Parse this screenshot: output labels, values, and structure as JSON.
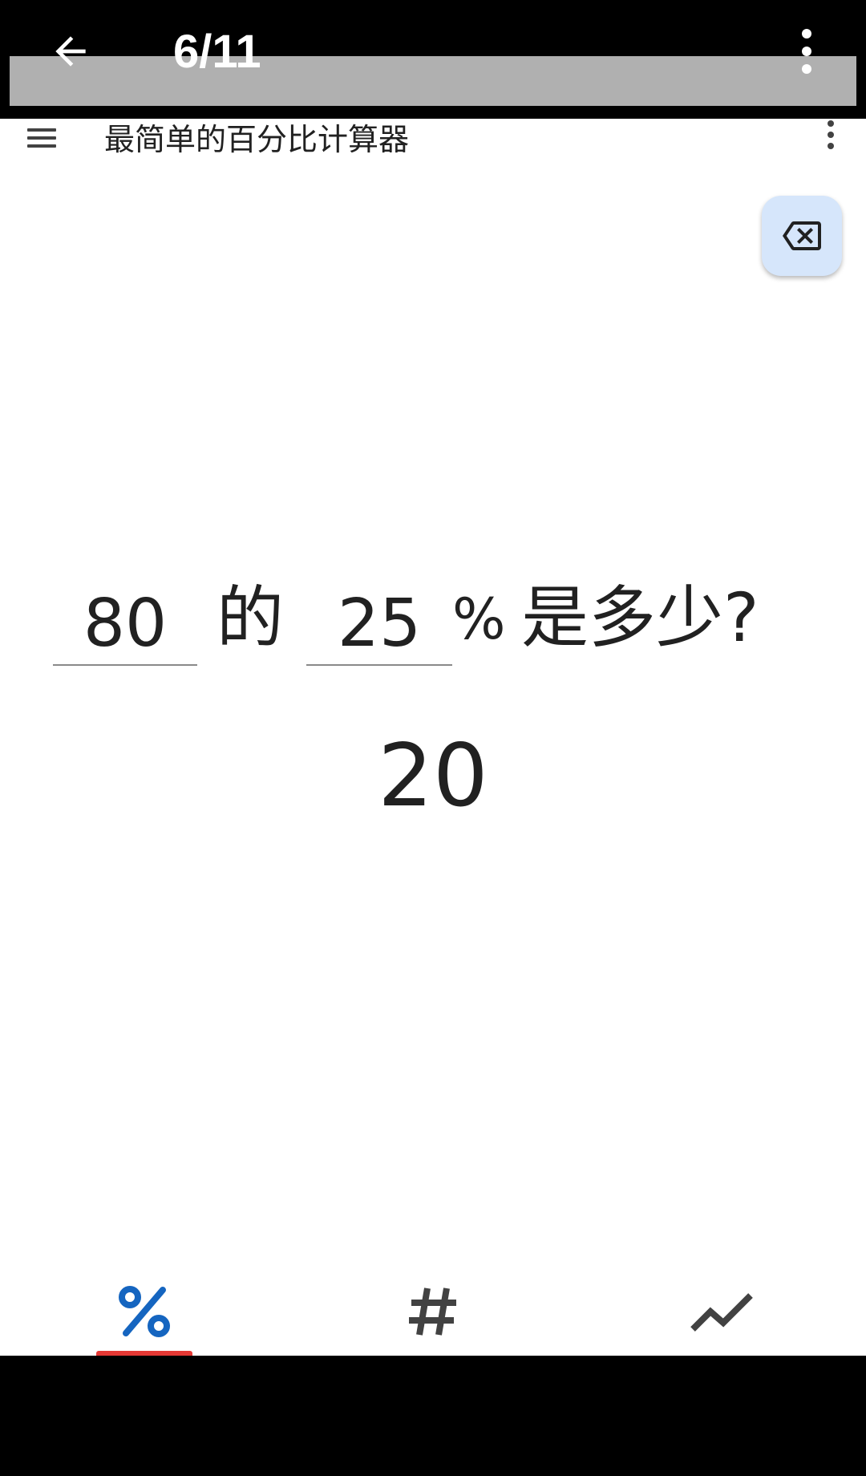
{
  "viewer": {
    "counter": "6/11",
    "back_icon": "arrow-left-icon",
    "menu_icon": "more-vert-icon"
  },
  "app_bar": {
    "title": "最简单的百分比计算器",
    "menu_icon": "hamburger-icon",
    "overflow_icon": "more-vert-icon"
  },
  "clear_button": {
    "icon": "backspace-icon",
    "color": "#d6e6fb"
  },
  "calculator": {
    "value_a": "80",
    "word_of": "的",
    "value_b": "25",
    "percent_sign": "%",
    "question_tail": "是多少?",
    "result": "20"
  },
  "bottom_nav": {
    "items": [
      {
        "icon": "percent-icon",
        "selected": true,
        "color": "#1565c0"
      },
      {
        "icon": "hash-icon",
        "selected": false,
        "color": "#424242"
      },
      {
        "icon": "trending-up-icon",
        "selected": false,
        "color": "#424242"
      }
    ],
    "indicator_color": "#e53935"
  }
}
